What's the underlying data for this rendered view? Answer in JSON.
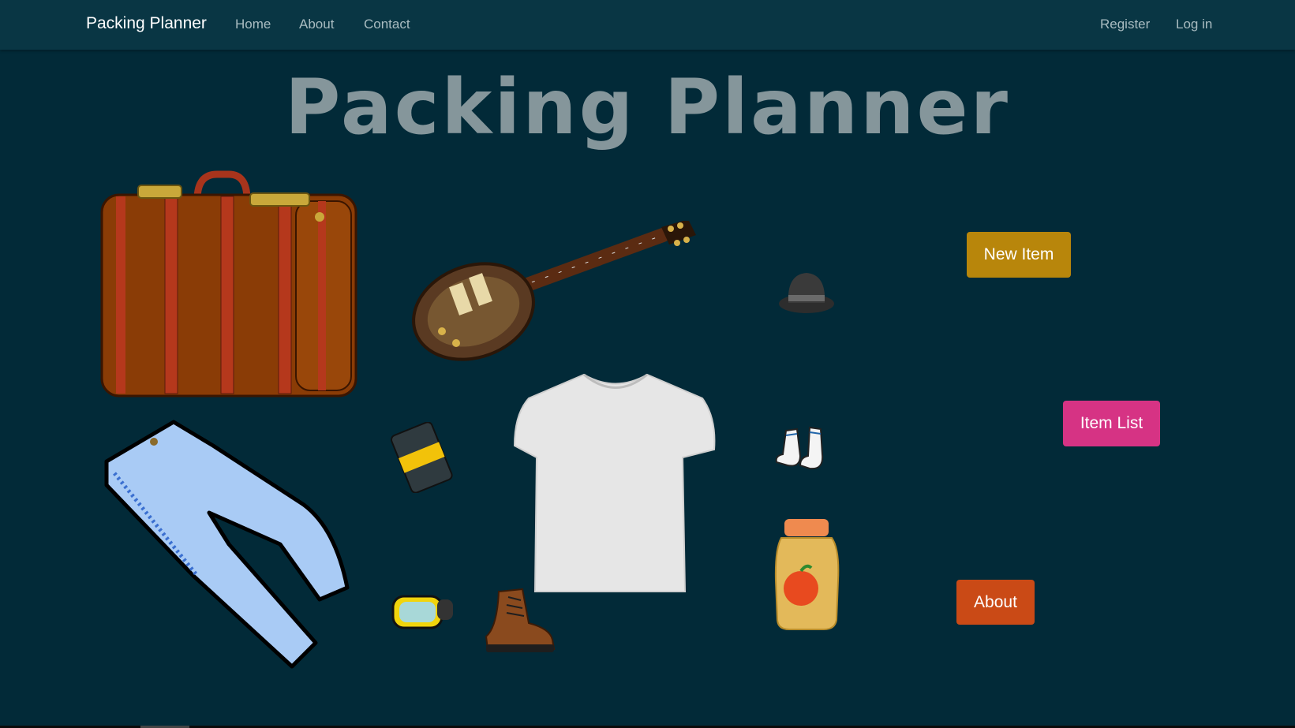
{
  "navbar": {
    "brand": "Packing Planner",
    "links": [
      "Home",
      "About",
      "Contact"
    ],
    "right_links": [
      "Register",
      "Log in"
    ]
  },
  "hero": {
    "title": "Packing Planner"
  },
  "buttons": {
    "new_item": "New Item",
    "item_list": "Item List",
    "about": "About"
  },
  "items": [
    "suitcase",
    "electric-guitar",
    "fedora-hat",
    "jeans",
    "notebook",
    "t-shirt",
    "socks",
    "jar",
    "snorkel-mask",
    "hiking-boot"
  ],
  "colors": {
    "background": "#022a38",
    "navbar": "#093644",
    "new_item_button": "#b8860b",
    "item_list_button": "#d63384",
    "about_button": "#ca4a16"
  }
}
